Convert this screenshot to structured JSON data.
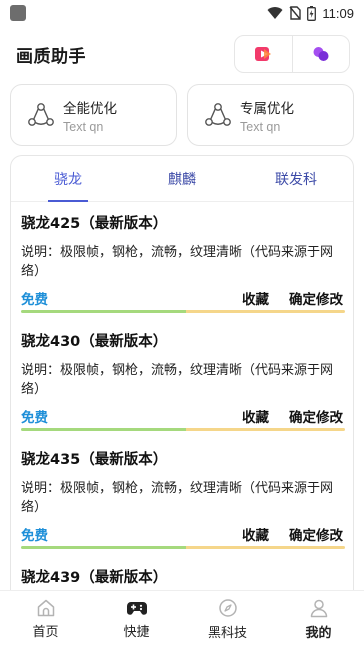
{
  "status_bar": {
    "time": "11:09"
  },
  "header": {
    "title": "画质助手",
    "actions": [
      {
        "icon": "play-icon",
        "color": "#f23a6b"
      },
      {
        "icon": "circles-icon",
        "color": "#8a3ce6"
      }
    ]
  },
  "cards": [
    {
      "title": "全能优化",
      "subtitle": "Text qn",
      "icon": "network-icon"
    },
    {
      "title": "专属优化",
      "subtitle": "Text qn",
      "icon": "network-icon"
    }
  ],
  "tabs": [
    {
      "label": "骁龙",
      "active": true
    },
    {
      "label": "麒麟",
      "active": false
    },
    {
      "label": "联发科",
      "active": false
    }
  ],
  "items": [
    {
      "title": "骁龙425（最新版本）",
      "description": "说明：极限帧，钢枪，流畅，纹理清晰（代码来源于网络）",
      "price": "免费",
      "favorite_label": "收藏",
      "confirm_label": "确定修改"
    },
    {
      "title": "骁龙430（最新版本）",
      "description": "说明：极限帧，钢枪，流畅，纹理清晰（代码来源于网络）",
      "price": "免费",
      "favorite_label": "收藏",
      "confirm_label": "确定修改"
    },
    {
      "title": "骁龙435（最新版本）",
      "description": "说明：极限帧，钢枪，流畅，纹理清晰（代码来源于网络）",
      "price": "免费",
      "favorite_label": "收藏",
      "confirm_label": "确定修改"
    },
    {
      "title": "骁龙439（最新版本）",
      "description": "",
      "price": "",
      "favorite_label": "",
      "confirm_label": ""
    }
  ],
  "bottom_nav": [
    {
      "label": "首页",
      "icon": "home-icon",
      "active": false
    },
    {
      "label": "快捷",
      "icon": "gamepad-icon",
      "active": false
    },
    {
      "label": "黑科技",
      "icon": "compass-icon",
      "active": false
    },
    {
      "label": "我的",
      "icon": "user-icon",
      "active": true
    }
  ],
  "colors": {
    "accent": "#4a5bd4",
    "price": "#1e8fd8",
    "divider_green": "#a5d97d",
    "divider_yellow": "#f5d68a"
  }
}
